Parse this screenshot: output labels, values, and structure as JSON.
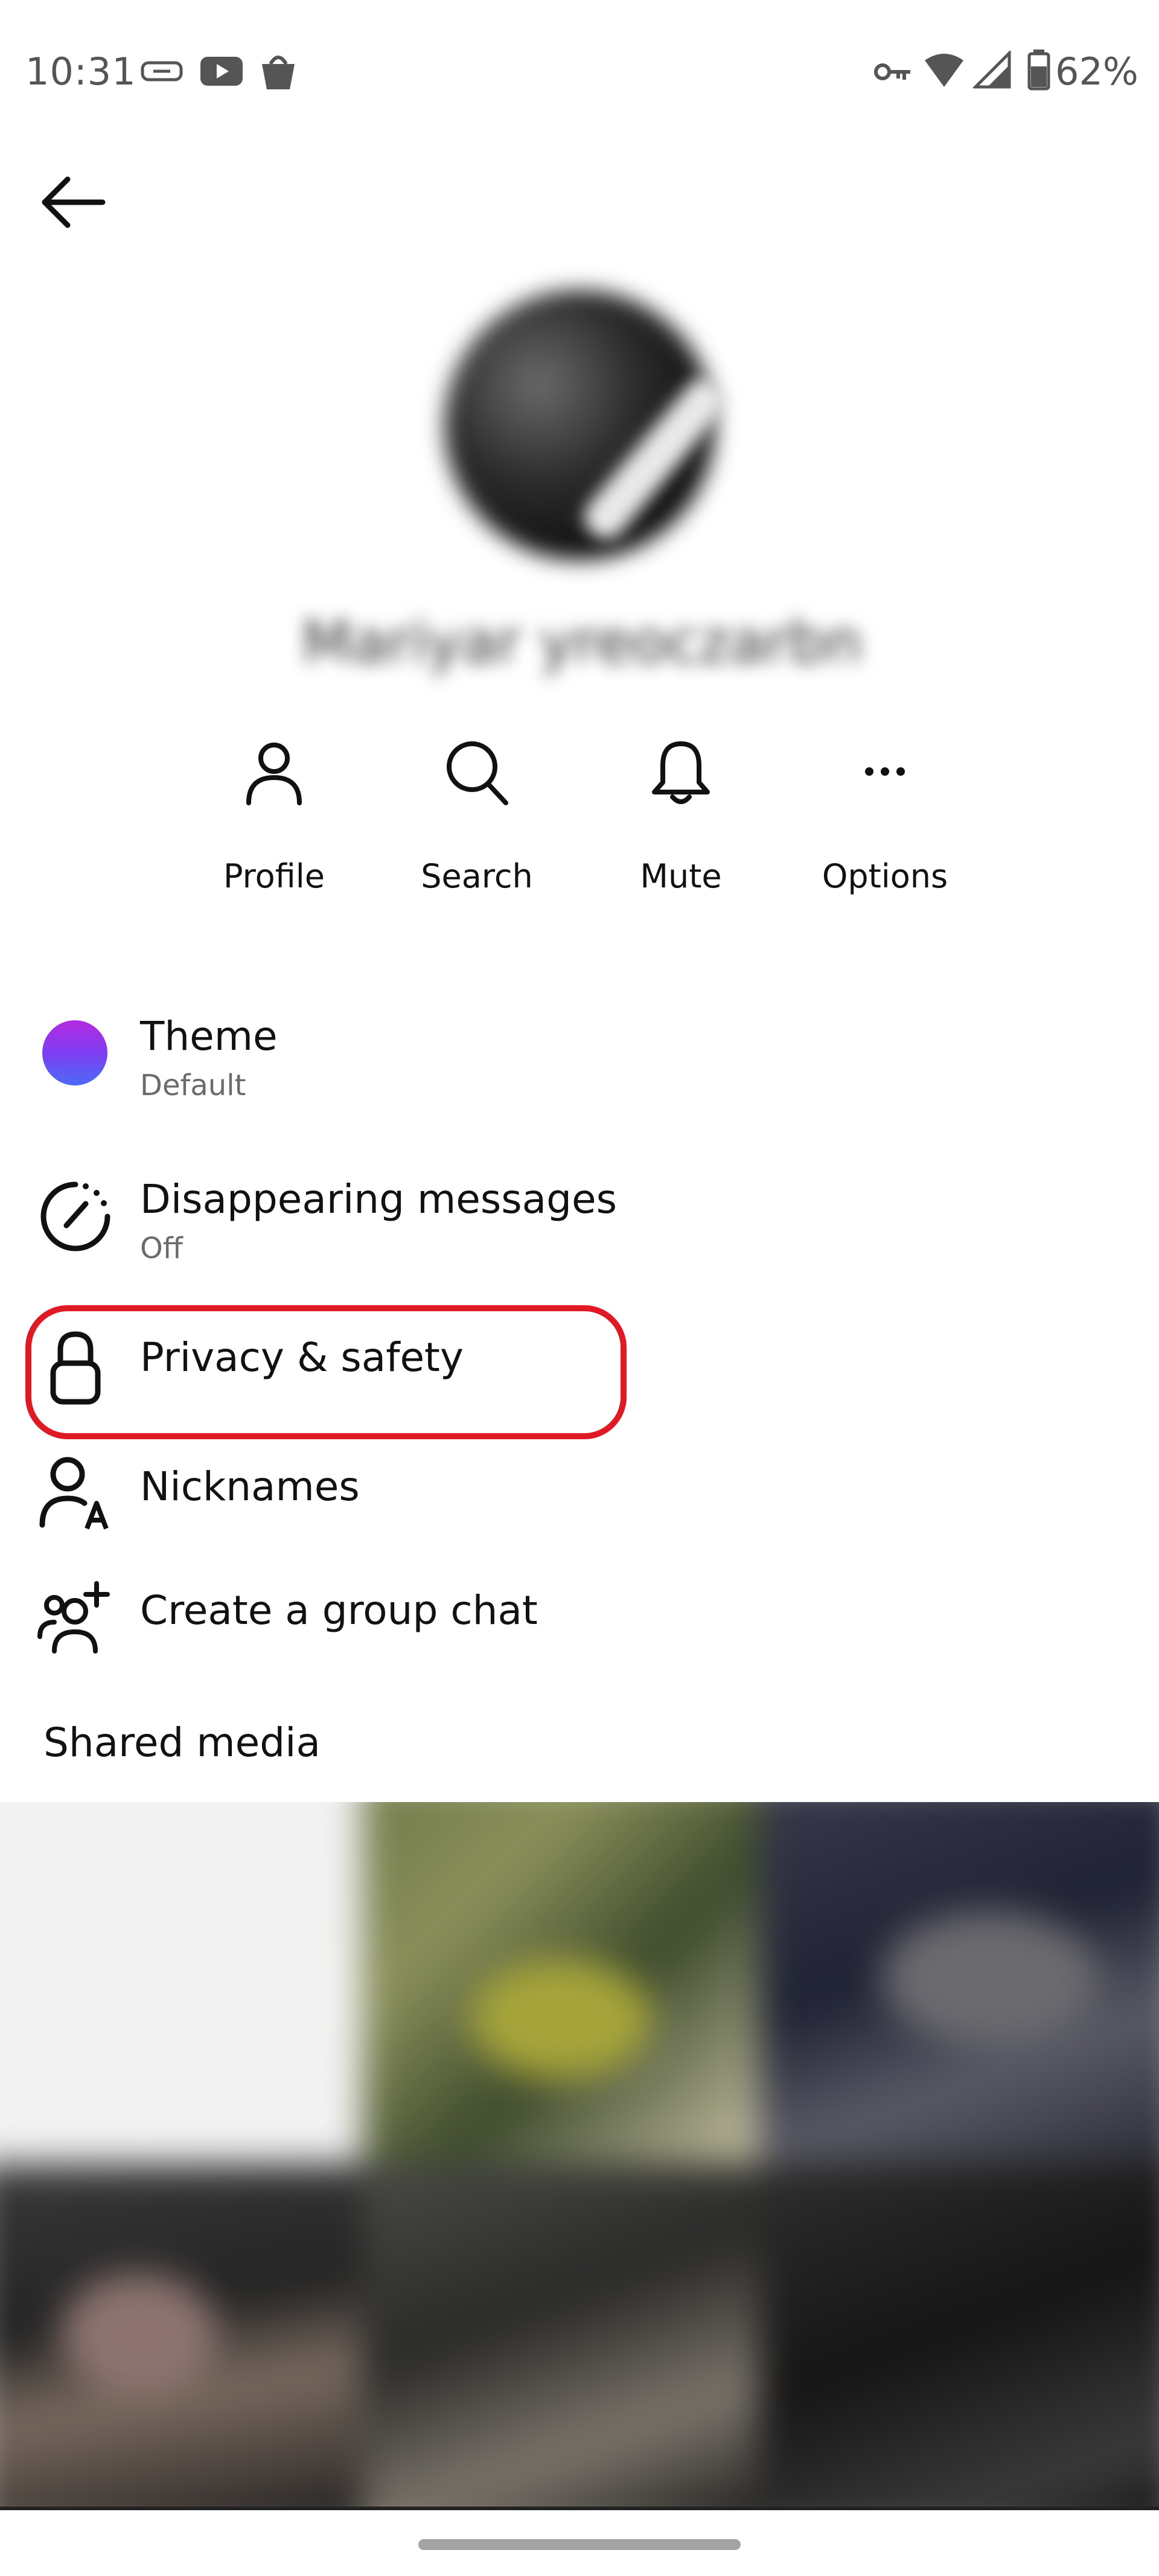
{
  "status_bar": {
    "time": "10:31",
    "battery_percent": "62%",
    "icons": [
      "link-icon",
      "youtube-icon",
      "shopping-bag-icon",
      "vpn-key-icon",
      "wifi-icon",
      "signal-icon",
      "battery-icon"
    ]
  },
  "header": {
    "back_icon": "arrow-left-icon"
  },
  "profile": {
    "name_obscured": "Mariyar yreoczarbn"
  },
  "actions": [
    {
      "label": "Profile",
      "icon": "person-icon"
    },
    {
      "label": "Search",
      "icon": "search-icon"
    },
    {
      "label": "Mute",
      "icon": "bell-icon"
    },
    {
      "label": "Options",
      "icon": "more-icon"
    }
  ],
  "settings": {
    "theme": {
      "title": "Theme",
      "subtitle": "Default"
    },
    "disappearing": {
      "title": "Disappearing messages",
      "subtitle": "Off"
    },
    "privacy": {
      "title": "Privacy & safety"
    },
    "nicknames": {
      "title": "Nicknames"
    },
    "group": {
      "title": "Create a group chat"
    }
  },
  "shared_media": {
    "title": "Shared media"
  },
  "colors": {
    "highlight": "#e01a24",
    "theme_gradient_top": "#b42be0",
    "theme_gradient_bottom": "#4b6bf7"
  }
}
